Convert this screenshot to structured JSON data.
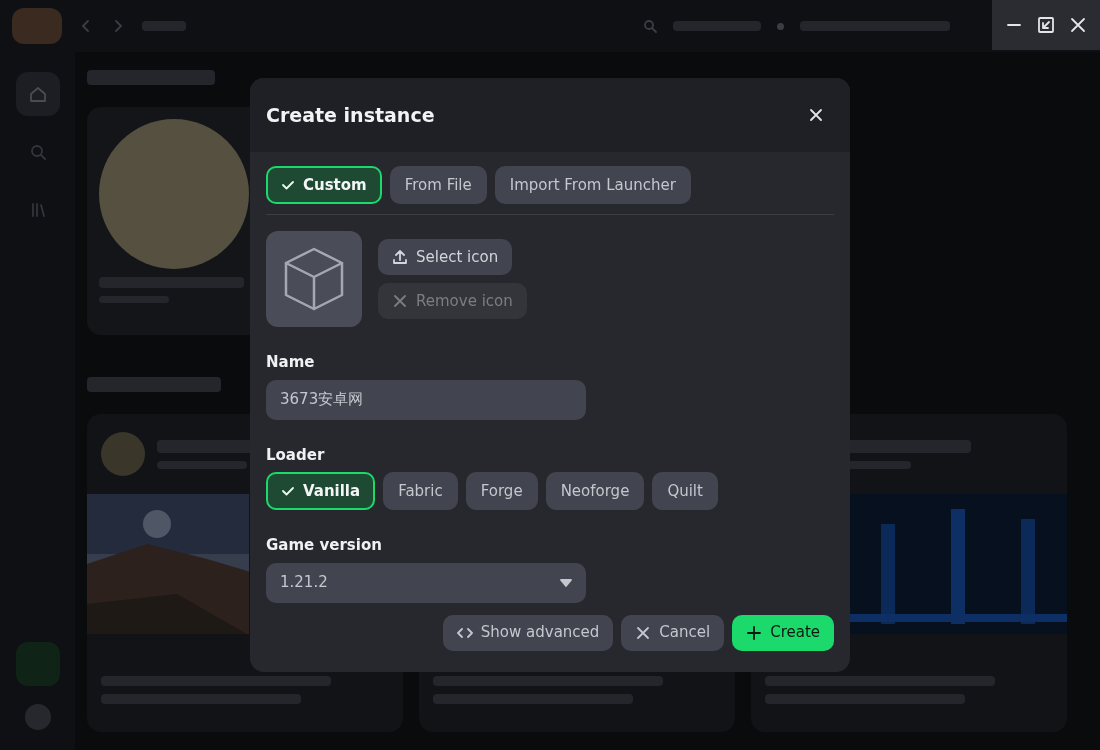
{
  "sidebar": {
    "items": [
      {
        "kind": "home",
        "selected": true
      },
      {
        "kind": "search",
        "selected": false
      },
      {
        "kind": "library",
        "selected": false
      }
    ]
  },
  "dialog": {
    "title": "Create instance",
    "source_tabs": [
      {
        "label": "Custom",
        "selected": true
      },
      {
        "label": "From File",
        "selected": false
      },
      {
        "label": "Import From Launcher",
        "selected": false
      }
    ],
    "icon_buttons": [
      {
        "label": "Select icon",
        "kind": "upload",
        "disabled": false
      },
      {
        "label": "Remove icon",
        "kind": "remove",
        "disabled": true
      }
    ],
    "name": {
      "label": "Name",
      "value": "3673安卓网"
    },
    "loader": {
      "label": "Loader",
      "options": [
        {
          "label": "Vanilla",
          "selected": true
        },
        {
          "label": "Fabric",
          "selected": false
        },
        {
          "label": "Forge",
          "selected": false
        },
        {
          "label": "Neoforge",
          "selected": false
        },
        {
          "label": "Quilt",
          "selected": false
        }
      ]
    },
    "game_version": {
      "label": "Game version",
      "value": "1.21.2"
    },
    "actions": [
      {
        "label": "Show advanced",
        "kind": "code"
      },
      {
        "label": "Cancel",
        "kind": "cancel"
      },
      {
        "label": "Create",
        "kind": "create"
      }
    ]
  }
}
